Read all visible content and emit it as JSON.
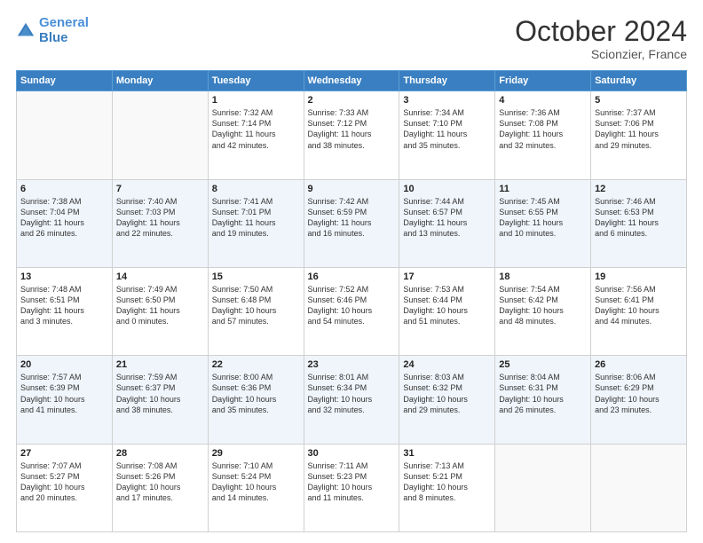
{
  "header": {
    "logo_line1": "General",
    "logo_line2": "Blue",
    "month": "October 2024",
    "location": "Scionzier, France"
  },
  "days_of_week": [
    "Sunday",
    "Monday",
    "Tuesday",
    "Wednesday",
    "Thursday",
    "Friday",
    "Saturday"
  ],
  "weeks": [
    [
      {
        "num": "",
        "lines": []
      },
      {
        "num": "",
        "lines": []
      },
      {
        "num": "1",
        "lines": [
          "Sunrise: 7:32 AM",
          "Sunset: 7:14 PM",
          "Daylight: 11 hours",
          "and 42 minutes."
        ]
      },
      {
        "num": "2",
        "lines": [
          "Sunrise: 7:33 AM",
          "Sunset: 7:12 PM",
          "Daylight: 11 hours",
          "and 38 minutes."
        ]
      },
      {
        "num": "3",
        "lines": [
          "Sunrise: 7:34 AM",
          "Sunset: 7:10 PM",
          "Daylight: 11 hours",
          "and 35 minutes."
        ]
      },
      {
        "num": "4",
        "lines": [
          "Sunrise: 7:36 AM",
          "Sunset: 7:08 PM",
          "Daylight: 11 hours",
          "and 32 minutes."
        ]
      },
      {
        "num": "5",
        "lines": [
          "Sunrise: 7:37 AM",
          "Sunset: 7:06 PM",
          "Daylight: 11 hours",
          "and 29 minutes."
        ]
      }
    ],
    [
      {
        "num": "6",
        "lines": [
          "Sunrise: 7:38 AM",
          "Sunset: 7:04 PM",
          "Daylight: 11 hours",
          "and 26 minutes."
        ]
      },
      {
        "num": "7",
        "lines": [
          "Sunrise: 7:40 AM",
          "Sunset: 7:03 PM",
          "Daylight: 11 hours",
          "and 22 minutes."
        ]
      },
      {
        "num": "8",
        "lines": [
          "Sunrise: 7:41 AM",
          "Sunset: 7:01 PM",
          "Daylight: 11 hours",
          "and 19 minutes."
        ]
      },
      {
        "num": "9",
        "lines": [
          "Sunrise: 7:42 AM",
          "Sunset: 6:59 PM",
          "Daylight: 11 hours",
          "and 16 minutes."
        ]
      },
      {
        "num": "10",
        "lines": [
          "Sunrise: 7:44 AM",
          "Sunset: 6:57 PM",
          "Daylight: 11 hours",
          "and 13 minutes."
        ]
      },
      {
        "num": "11",
        "lines": [
          "Sunrise: 7:45 AM",
          "Sunset: 6:55 PM",
          "Daylight: 11 hours",
          "and 10 minutes."
        ]
      },
      {
        "num": "12",
        "lines": [
          "Sunrise: 7:46 AM",
          "Sunset: 6:53 PM",
          "Daylight: 11 hours",
          "and 6 minutes."
        ]
      }
    ],
    [
      {
        "num": "13",
        "lines": [
          "Sunrise: 7:48 AM",
          "Sunset: 6:51 PM",
          "Daylight: 11 hours",
          "and 3 minutes."
        ]
      },
      {
        "num": "14",
        "lines": [
          "Sunrise: 7:49 AM",
          "Sunset: 6:50 PM",
          "Daylight: 11 hours",
          "and 0 minutes."
        ]
      },
      {
        "num": "15",
        "lines": [
          "Sunrise: 7:50 AM",
          "Sunset: 6:48 PM",
          "Daylight: 10 hours",
          "and 57 minutes."
        ]
      },
      {
        "num": "16",
        "lines": [
          "Sunrise: 7:52 AM",
          "Sunset: 6:46 PM",
          "Daylight: 10 hours",
          "and 54 minutes."
        ]
      },
      {
        "num": "17",
        "lines": [
          "Sunrise: 7:53 AM",
          "Sunset: 6:44 PM",
          "Daylight: 10 hours",
          "and 51 minutes."
        ]
      },
      {
        "num": "18",
        "lines": [
          "Sunrise: 7:54 AM",
          "Sunset: 6:42 PM",
          "Daylight: 10 hours",
          "and 48 minutes."
        ]
      },
      {
        "num": "19",
        "lines": [
          "Sunrise: 7:56 AM",
          "Sunset: 6:41 PM",
          "Daylight: 10 hours",
          "and 44 minutes."
        ]
      }
    ],
    [
      {
        "num": "20",
        "lines": [
          "Sunrise: 7:57 AM",
          "Sunset: 6:39 PM",
          "Daylight: 10 hours",
          "and 41 minutes."
        ]
      },
      {
        "num": "21",
        "lines": [
          "Sunrise: 7:59 AM",
          "Sunset: 6:37 PM",
          "Daylight: 10 hours",
          "and 38 minutes."
        ]
      },
      {
        "num": "22",
        "lines": [
          "Sunrise: 8:00 AM",
          "Sunset: 6:36 PM",
          "Daylight: 10 hours",
          "and 35 minutes."
        ]
      },
      {
        "num": "23",
        "lines": [
          "Sunrise: 8:01 AM",
          "Sunset: 6:34 PM",
          "Daylight: 10 hours",
          "and 32 minutes."
        ]
      },
      {
        "num": "24",
        "lines": [
          "Sunrise: 8:03 AM",
          "Sunset: 6:32 PM",
          "Daylight: 10 hours",
          "and 29 minutes."
        ]
      },
      {
        "num": "25",
        "lines": [
          "Sunrise: 8:04 AM",
          "Sunset: 6:31 PM",
          "Daylight: 10 hours",
          "and 26 minutes."
        ]
      },
      {
        "num": "26",
        "lines": [
          "Sunrise: 8:06 AM",
          "Sunset: 6:29 PM",
          "Daylight: 10 hours",
          "and 23 minutes."
        ]
      }
    ],
    [
      {
        "num": "27",
        "lines": [
          "Sunrise: 7:07 AM",
          "Sunset: 5:27 PM",
          "Daylight: 10 hours",
          "and 20 minutes."
        ]
      },
      {
        "num": "28",
        "lines": [
          "Sunrise: 7:08 AM",
          "Sunset: 5:26 PM",
          "Daylight: 10 hours",
          "and 17 minutes."
        ]
      },
      {
        "num": "29",
        "lines": [
          "Sunrise: 7:10 AM",
          "Sunset: 5:24 PM",
          "Daylight: 10 hours",
          "and 14 minutes."
        ]
      },
      {
        "num": "30",
        "lines": [
          "Sunrise: 7:11 AM",
          "Sunset: 5:23 PM",
          "Daylight: 10 hours",
          "and 11 minutes."
        ]
      },
      {
        "num": "31",
        "lines": [
          "Sunrise: 7:13 AM",
          "Sunset: 5:21 PM",
          "Daylight: 10 hours",
          "and 8 minutes."
        ]
      },
      {
        "num": "",
        "lines": []
      },
      {
        "num": "",
        "lines": []
      }
    ]
  ]
}
